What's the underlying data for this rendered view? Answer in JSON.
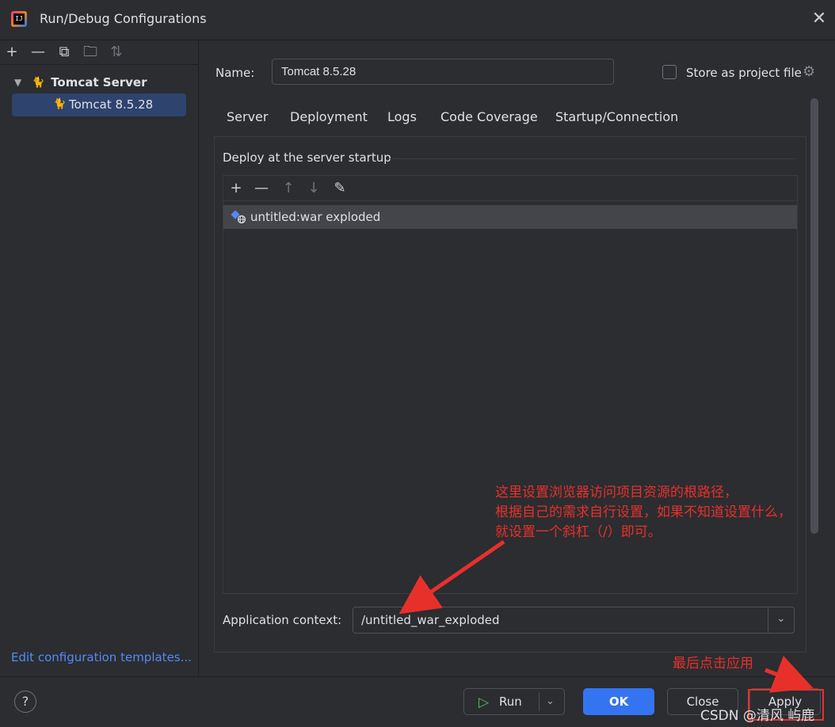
{
  "window": {
    "title": "Run/Debug Configurations",
    "close_glyph": "✕"
  },
  "left_toolbar": {
    "icons": [
      "add-icon",
      "remove-icon",
      "copy-icon",
      "new-folder-icon",
      "sort-icon"
    ],
    "add_glyph": "+",
    "remove_glyph": "—",
    "copy_glyph": "⧉",
    "folder_glyph": "🗀",
    "sort_glyph": "⇅"
  },
  "tree": {
    "group_label": "Tomcat Server",
    "selected_item_label": "Tomcat 8.5.28"
  },
  "edit_templates_link": "Edit configuration templates...",
  "form": {
    "name_label": "Name:",
    "name_value": "Tomcat 8.5.28",
    "store_label": "Store as project file"
  },
  "tabs": [
    {
      "label": "Server",
      "active": false
    },
    {
      "label": "Deployment",
      "active": true
    },
    {
      "label": "Logs",
      "active": false
    },
    {
      "label": "Code Coverage",
      "active": false
    },
    {
      "label": "Startup/Connection",
      "active": false
    }
  ],
  "deployment": {
    "section_label": "Deploy at the server startup",
    "toolbar_glyphs": {
      "add": "+",
      "remove": "—",
      "up": "↑",
      "down": "↓",
      "edit": "✎"
    },
    "artifacts": [
      "untitled:war exploded"
    ],
    "context_label": "Application context:",
    "context_value": "/untitled_war_exploded"
  },
  "buttons": {
    "help": "?",
    "run": "Run",
    "ok": "OK",
    "close": "Close",
    "apply": "Apply"
  },
  "annotations": {
    "context_note_line1": "这里设置浏览器访问项目资源的根路径，",
    "context_note_line2": "根据自己的需求自行设置，如果不知道设置什么，",
    "context_note_line3": "就设置一个斜杠（/）即可。",
    "apply_note": "最后点击应用",
    "color": "#e8302b"
  },
  "watermark": "CSDN @清风 屿鹿",
  "colors": {
    "accent": "#3574f0",
    "selection": "#2e436e",
    "background": "#2b2d30"
  }
}
